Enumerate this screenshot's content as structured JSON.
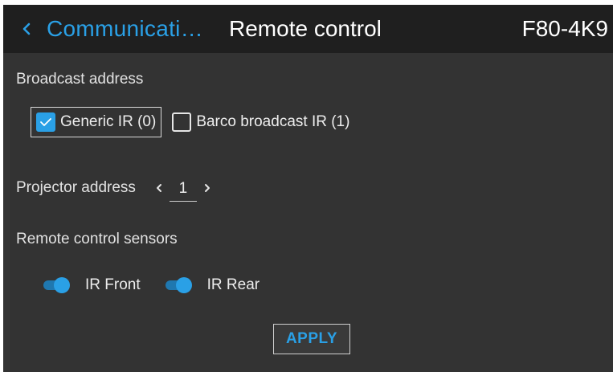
{
  "header": {
    "back_label": "Communicati…",
    "title": "Remote control",
    "model": "F80-4K9"
  },
  "broadcast": {
    "label": "Broadcast address",
    "options": [
      {
        "label": "Generic IR (0)",
        "checked": true
      },
      {
        "label": "Barco broadcast IR (1)",
        "checked": false
      }
    ]
  },
  "projector_address": {
    "label": "Projector address",
    "value": "1"
  },
  "sensors": {
    "label": "Remote control sensors",
    "items": [
      {
        "label": "IR Front",
        "on": true
      },
      {
        "label": "IR Rear",
        "on": true
      }
    ]
  },
  "apply_label": "APPLY",
  "colors": {
    "accent": "#2aa0e6",
    "background": "#333333",
    "header_background": "#1f1f1f"
  },
  "icons": {
    "back": "chevron-left-icon",
    "decrement": "chevron-left-icon",
    "increment": "chevron-right-icon",
    "check": "checkmark-icon"
  }
}
